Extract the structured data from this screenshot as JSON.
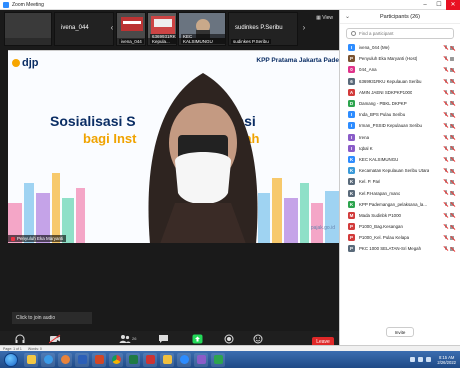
{
  "window": {
    "title": "Zoom Meeting"
  },
  "thumbnails": [
    {
      "name": "",
      "big_label": ""
    },
    {
      "name": "",
      "big_label": "ivena_044"
    },
    {
      "name": "ivena_044",
      "big_label": ""
    },
    {
      "name": "6369931RKUPAN Kepula...",
      "big_label": ""
    },
    {
      "name": "KEC KALSIMUNGU",
      "big_label": ""
    },
    {
      "name": "sudinkes P.Seribu",
      "big_label": "sudinkes P.Seribu"
    }
  ],
  "stage": {
    "logo_text": "djp",
    "header_right": "KPP Pratama Jakarta Pade",
    "slide_title": "Sosialisasi S",
    "slide_title_right": "fikasi",
    "slide_subtitle": "bagi Inst",
    "slide_subtitle_right": "tah",
    "site_text": "pajak.go.id",
    "speaker": "Penyuluh Eka Maryanti"
  },
  "audio_prompt": "Click to join audio",
  "toolbar": {
    "join_audio": "Join Audio",
    "start_video": "Start Video",
    "participants": "Participants",
    "participants_count": "26",
    "chat": "Chat",
    "share_screen": "Share Screen",
    "record": "Record",
    "reactions": "Reactions",
    "leave": "Leave"
  },
  "panel": {
    "title": "Participants (26)",
    "search_placeholder": "Find a participant",
    "invite": "Invite",
    "participants": [
      {
        "initial": "I",
        "color": "#2d8cff",
        "name": "ivena_044 (Me)",
        "video": "off"
      },
      {
        "initial": "P",
        "color": "#7a5230",
        "name": "Penyuluh Eka Maryanti (Host)",
        "video": "on"
      },
      {
        "initial": "0",
        "color": "#e0338a",
        "name": "044_Ana",
        "video": "off"
      },
      {
        "initial": "6",
        "color": "#5a6a7a",
        "name": "6369931RKU Kepulauan Seribu",
        "video": "off"
      },
      {
        "initial": "A",
        "color": "#d23b3b",
        "name": "AMIN JAENI SDKPKP1000",
        "video": "off"
      },
      {
        "initial": "D",
        "color": "#2da44e",
        "name": "Damang - PBKL DKPKP",
        "video": "off"
      },
      {
        "initial": "I",
        "color": "#2d8cff",
        "name": "Inda_BPS Pulau Seribu",
        "video": "off"
      },
      {
        "initial": "I",
        "color": "#2d8cff",
        "name": "Irman_PSSID Kepulauan Seribu",
        "video": "off"
      },
      {
        "initial": "I",
        "color": "#8a5cc8",
        "name": "Irena",
        "video": "off"
      },
      {
        "initial": "I",
        "color": "#8a5cc8",
        "name": "Iqbal K",
        "video": "off"
      },
      {
        "initial": "K",
        "color": "#2d8cff",
        "name": "KEC KALSIMUNGU",
        "video": "off"
      },
      {
        "initial": "K",
        "color": "#3a9ad9",
        "name": "Kecamatan Kepulauan Seribu Utara",
        "video": "off"
      },
      {
        "initial": "K",
        "color": "#5a6a7a",
        "name": "Kel. P. Pari",
        "video": "off"
      },
      {
        "initial": "K",
        "color": "#5a6a7a",
        "name": "Kel.P.Harapan_mano",
        "video": "off"
      },
      {
        "initial": "K",
        "color": "#2da44e",
        "name": "KPP Pademangan_pelaksana_la...",
        "video": "off"
      },
      {
        "initial": "M",
        "color": "#d23b3b",
        "name": "Mada Sudinbk P1000",
        "video": "off"
      },
      {
        "initial": "P",
        "color": "#d23b3b",
        "name": "P1000_Bag.Kesangan",
        "video": "off"
      },
      {
        "initial": "P",
        "color": "#d23b3b",
        "name": "P1000_Kel. Pulau Kelapa",
        "video": "off"
      },
      {
        "initial": "P",
        "color": "#5a6a7a",
        "name": "PKC 1000 SELATAN-Sri Megah",
        "video": "off"
      }
    ]
  },
  "statusbar": {
    "page": "Page: 1 of 1",
    "words": "Words: 0"
  },
  "taskbar": {
    "time": "8:15 AM",
    "date": "2/26/2022"
  }
}
